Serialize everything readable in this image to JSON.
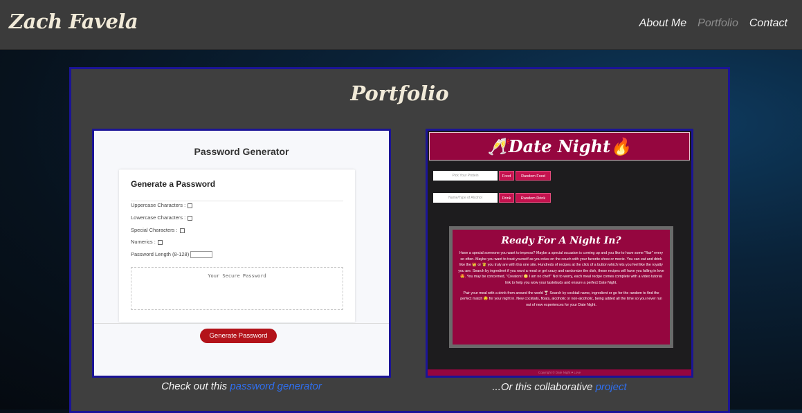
{
  "header": {
    "brand": "Zach Favela",
    "nav": [
      {
        "label": "About Me",
        "active": false
      },
      {
        "label": "Portfolio",
        "active": true
      },
      {
        "label": "Contact",
        "active": false
      }
    ]
  },
  "portfolio": {
    "title": "Portfolio",
    "projects": [
      {
        "caption_prefix": "Check out this ",
        "link_text": "password generator",
        "preview": {
          "title": "Password Generator",
          "heading": "Generate a Password",
          "options": [
            "Uppercase Characters :",
            "Lowercase Characters :",
            "Special Characters :",
            "Numerics :"
          ],
          "length_label": "Password Length (8-128)",
          "textarea_placeholder": "Your Secure Password",
          "button": "Generate Password"
        }
      },
      {
        "caption_prefix": "...Or this collaborative ",
        "link_text": "project",
        "preview": {
          "title": "🥂Date Night🔥",
          "protein_placeholder": "Pick Your Protein",
          "food_button": "Food",
          "random_food_button": "Random Food",
          "alcohol_placeholder": "Name/Type of Alcohol",
          "drink_button": "Drink",
          "random_drink_button": "Random Drink",
          "card_title": "Ready For A Night In?",
          "paragraph_1": "Have a special someone you want to impress? Maybe a special occasion is coming up and you like to have some \"flair\" every so often. Maybe you want to treat yourself as you relax on the couch with your favorite show or movie. You can eat and drink like the 👑 or 👸 you truly are with this one site. Hundreds of recipes at the click of a button which lets you feel like the royalty you are. Search by ingredient if you want a meal or get crazy and randomize the dish, these recipes will have you falling in love😍. You may be concerned, \"Creators! 😳 I am no chef!\" Not to worry, each meal recipe comes complete with a video tutorial link to help you wow your tastebuds and ensure a perfect Date Night.",
          "paragraph_2": "Pair your meal with a drink from around the world 🍸 Search by cocktail name, ingredient or go for the random to find the perfect match 😉 for your night in. New cocktails, floats, alcoholic or non-alcoholic, being added all the time so you never run out of new experiences for your Date Night.",
          "footer": "Copyright © Date Night ♥ Love"
        }
      }
    ]
  },
  "colors": {
    "header_bg": "#3b3b3b",
    "panel_bg": "#3f3f3f",
    "panel_border": "#1b1496",
    "link": "#2f6ff0",
    "date_night_accent": "#95063f",
    "generate_button": "#b3131a"
  }
}
